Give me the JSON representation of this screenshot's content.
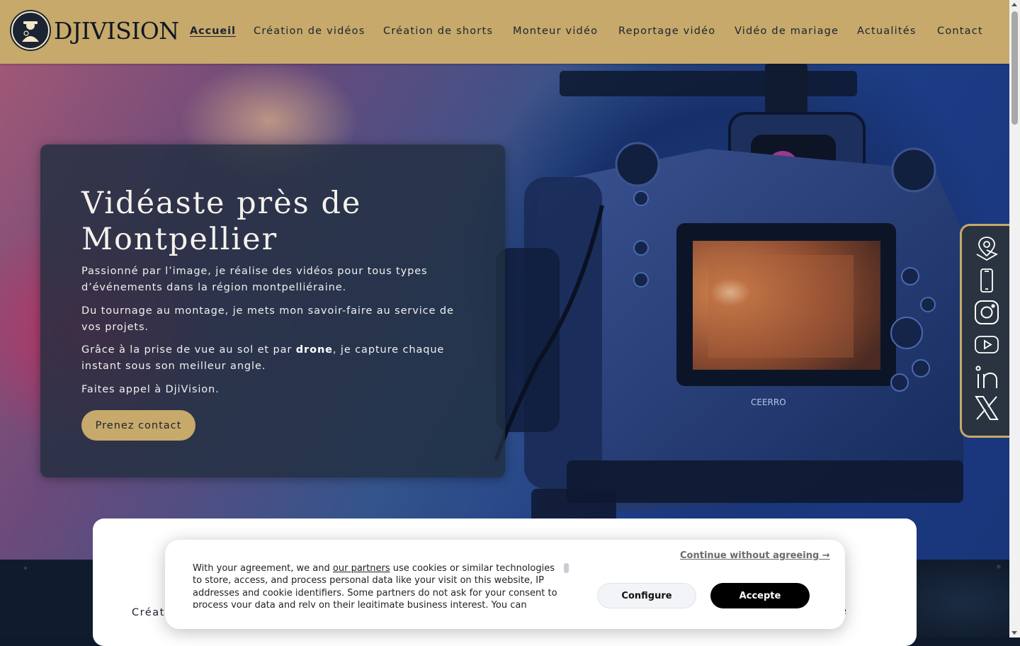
{
  "brand": {
    "logo_text": "DJIVISION",
    "accent_color": "#c6a96b",
    "dark_color": "#1c2430"
  },
  "nav": {
    "items": [
      {
        "label": "Accueil",
        "active": true
      },
      {
        "label": "Création de vidéos"
      },
      {
        "label": "Création de shorts"
      },
      {
        "label": "Monteur vidéo"
      },
      {
        "label": "Reportage vidéo"
      },
      {
        "label": "Vidéo de mariage"
      },
      {
        "label": "Actualités"
      },
      {
        "label": "Contact"
      }
    ]
  },
  "hero": {
    "title": "Vidéaste près de Montpellier",
    "p1": "Passionné par l’image, je réalise des vidéos pour tous types d’événements dans la région montpelliéraine.",
    "p2": "Du tournage au montage, je mets mon savoir-faire au service de vos projets.",
    "p3_before": "Grâce à la prise de vue au sol et par ",
    "p3_bold": "drone",
    "p3_after": ", je capture chaque instant sous son meilleur angle.",
    "p4": "Faites appel à DjiVision.",
    "cta_label": "Prenez contact",
    "camera_brand": "CEERRO"
  },
  "social": {
    "icons": [
      "location-pin-icon",
      "smartphone-icon",
      "instagram-icon",
      "youtube-icon",
      "linkedin-icon",
      "x-icon"
    ]
  },
  "panel": {
    "left_text": "Créati",
    "right_text": "é"
  },
  "cookie": {
    "text_before": "With your agreement, we and ",
    "partners_link": "our partners",
    "text_after": " use cookies or similar technologies to store, access, and process personal data like your visit on this website, IP addresses and cookie identifiers. Some partners do not ask for your consent to process your data and rely on their legitimate business interest. You can",
    "continue_label": "Continue without agreeing →",
    "configure_label": "Configure",
    "accept_label": "Accepte"
  }
}
